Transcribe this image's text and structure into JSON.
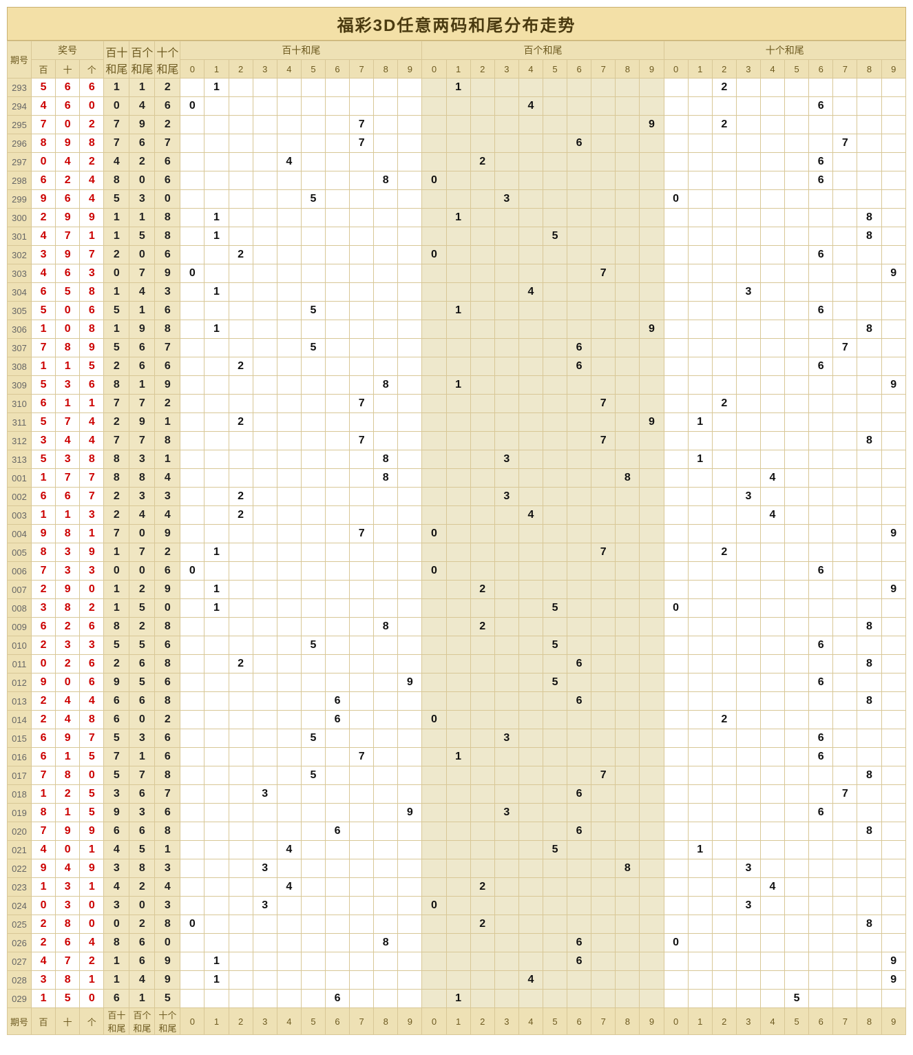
{
  "title": "福彩3D任意两码和尾分布走势",
  "headers": {
    "period": "期号",
    "nums": "奖号",
    "num_sub": [
      "百",
      "十",
      "个"
    ],
    "sums": [
      "百十和尾",
      "百个和尾",
      "十个和尾"
    ],
    "groups": [
      "百十和尾",
      "百个和尾",
      "十个和尾"
    ],
    "digits": [
      "0",
      "1",
      "2",
      "3",
      "4",
      "5",
      "6",
      "7",
      "8",
      "9"
    ]
  },
  "chart_data": {
    "type": "table",
    "note": "each row: [period, d1, d2, d3]; sums = (d1+d2)%10, (d1+d3)%10, (d2+d3)%10; marked in corresponding 0-9 column of each group",
    "rows": [
      [
        "293",
        5,
        6,
        6
      ],
      [
        "294",
        4,
        6,
        0
      ],
      [
        "295",
        7,
        0,
        2
      ],
      [
        "296",
        8,
        9,
        8
      ],
      [
        "297",
        0,
        4,
        2
      ],
      [
        "298",
        6,
        2,
        4
      ],
      [
        "299",
        9,
        6,
        4
      ],
      [
        "300",
        2,
        9,
        9
      ],
      [
        "301",
        4,
        7,
        1
      ],
      [
        "302",
        3,
        9,
        7
      ],
      [
        "303",
        4,
        6,
        3
      ],
      [
        "304",
        6,
        5,
        8
      ],
      [
        "305",
        5,
        0,
        6
      ],
      [
        "306",
        1,
        0,
        8
      ],
      [
        "307",
        7,
        8,
        9
      ],
      [
        "308",
        1,
        1,
        5
      ],
      [
        "309",
        5,
        3,
        6
      ],
      [
        "310",
        6,
        1,
        1
      ],
      [
        "311",
        5,
        7,
        4
      ],
      [
        "312",
        3,
        4,
        4
      ],
      [
        "313",
        5,
        3,
        8
      ],
      [
        "001",
        1,
        7,
        7
      ],
      [
        "002",
        6,
        6,
        7
      ],
      [
        "003",
        1,
        1,
        3
      ],
      [
        "004",
        9,
        8,
        1
      ],
      [
        "005",
        8,
        3,
        9
      ],
      [
        "006",
        7,
        3,
        3
      ],
      [
        "007",
        2,
        9,
        0
      ],
      [
        "008",
        3,
        8,
        2
      ],
      [
        "009",
        6,
        2,
        6
      ],
      [
        "010",
        2,
        3,
        3
      ],
      [
        "011",
        0,
        2,
        6
      ],
      [
        "012",
        9,
        0,
        6
      ],
      [
        "013",
        2,
        4,
        4
      ],
      [
        "014",
        2,
        4,
        8
      ],
      [
        "015",
        6,
        9,
        7
      ],
      [
        "016",
        6,
        1,
        5
      ],
      [
        "017",
        7,
        8,
        0
      ],
      [
        "018",
        1,
        2,
        5
      ],
      [
        "019",
        8,
        1,
        5
      ],
      [
        "020",
        7,
        9,
        9
      ],
      [
        "021",
        4,
        0,
        1
      ],
      [
        "022",
        9,
        4,
        9
      ],
      [
        "023",
        1,
        3,
        1
      ],
      [
        "024",
        0,
        3,
        0
      ],
      [
        "025",
        2,
        8,
        0
      ],
      [
        "026",
        2,
        6,
        4
      ],
      [
        "027",
        4,
        7,
        2
      ],
      [
        "028",
        3,
        8,
        1
      ],
      [
        "029",
        1,
        5,
        0
      ]
    ]
  }
}
